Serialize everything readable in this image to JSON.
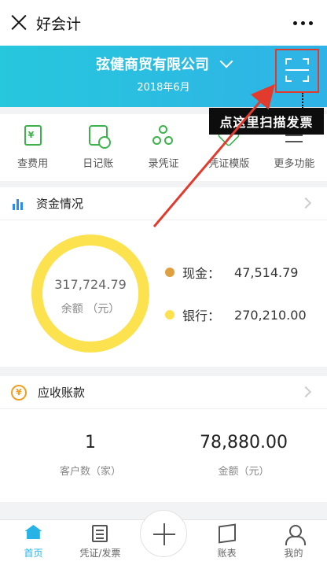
{
  "titlebar": {
    "title": "好会计",
    "close_icon": "close-icon",
    "more_icon": "more-dots-icon"
  },
  "header": {
    "company": "弦健商贸有限公司",
    "period": "2018年6月"
  },
  "annotation": {
    "text": "点这里扫描发票",
    "color": "#e23b2e"
  },
  "quick": [
    {
      "label": "查费用",
      "icon": "expense-doc-icon"
    },
    {
      "label": "日记账",
      "icon": "journal-icon"
    },
    {
      "label": "录凭证",
      "icon": "voucher-entry-icon"
    },
    {
      "label": "凭证模版",
      "icon": "voucher-template-icon"
    },
    {
      "label": "更多功能",
      "icon": "more-functions-icon"
    }
  ],
  "funds": {
    "title": "资金情况",
    "total": "317,724.79",
    "total_label": "余额 （元）",
    "items": [
      {
        "label": "现金：",
        "value": "47,514.79",
        "color": "#e0a040"
      },
      {
        "label": "银行：",
        "value": "270,210.00",
        "color": "#fbe24e"
      }
    ]
  },
  "receivables": {
    "title": "应收账款",
    "customers": "1",
    "customers_label": "客户数（家）",
    "amount": "78,880.00",
    "amount_label": "金额（元）"
  },
  "tabs": [
    {
      "label": "首页",
      "active": true
    },
    {
      "label": "凭证/发票",
      "active": false
    },
    {
      "label": "账表",
      "active": false
    },
    {
      "label": "我的",
      "active": false
    }
  ],
  "colors": {
    "accent": "#27b3e5",
    "green": "#3bb24a",
    "ring": "#fbe24e"
  }
}
